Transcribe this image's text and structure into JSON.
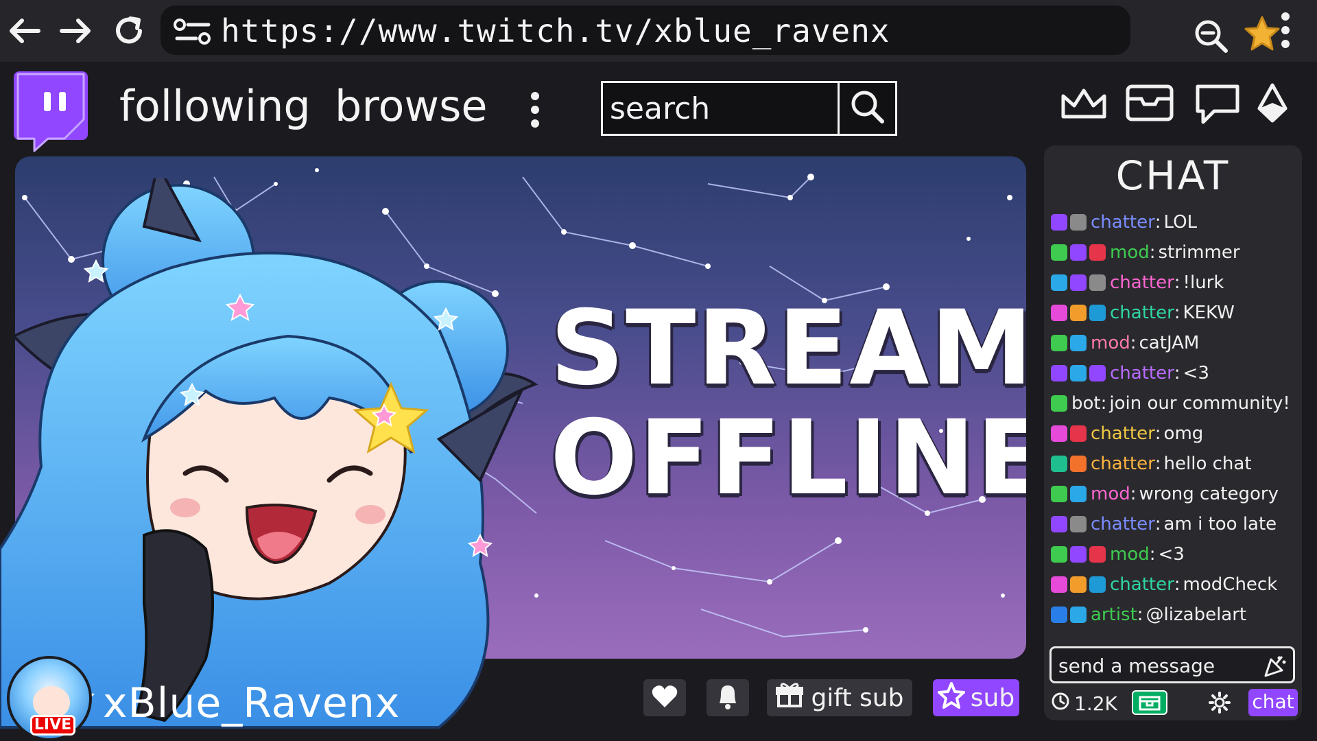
{
  "browser": {
    "url": "https://www.twitch.tv/xblue_ravenx"
  },
  "header": {
    "following_label": "following",
    "browse_label": "browse",
    "search_placeholder": "search"
  },
  "stream": {
    "offline_line1": "STREAM",
    "offline_line2": "OFFLINE"
  },
  "channel": {
    "name": "xBlue_Ravenx",
    "live_badge": "LIVE",
    "gift_label": "gift sub",
    "sub_label": "sub"
  },
  "chat": {
    "title": "CHAT",
    "messages": [
      {
        "user": "chatter",
        "text": "LOL",
        "color": "#7b8cff",
        "badges": [
          "#9147ff",
          "#8a8a8a"
        ]
      },
      {
        "user": "mod",
        "text": "strimmer",
        "color": "#3ecb4f",
        "badges": [
          "#3ecb4f",
          "#9147ff",
          "#e6344a"
        ]
      },
      {
        "user": "chatter",
        "text": "!lurk",
        "color": "#ff66d1",
        "badges": [
          "#2aa8e8",
          "#9147ff",
          "#8a8a8a"
        ]
      },
      {
        "user": "chatter",
        "text": "KEKW",
        "color": "#2fd6a0",
        "badges": [
          "#e64ad8",
          "#f29d2b",
          "#1e9ad6"
        ]
      },
      {
        "user": "mod",
        "text": "catJAM",
        "color": "#ff7aa8",
        "badges": [
          "#3ecb4f",
          "#2aa8e8"
        ]
      },
      {
        "user": "chatter",
        "text": "<3",
        "color": "#b96bff",
        "badges": [
          "#9147ff",
          "#2aa8e8",
          "#9147ff"
        ]
      },
      {
        "user": "bot",
        "text": "join our community!",
        "color": "#f0f0f0",
        "badges": [
          "#3ecb4f"
        ]
      },
      {
        "user": "chatter",
        "text": "omg",
        "color": "#f2c744",
        "badges": [
          "#e64ad8",
          "#e6344a"
        ]
      },
      {
        "user": "chatter",
        "text": "hello chat",
        "color": "#ffb340",
        "badges": [
          "#1fbf8f",
          "#f2712b"
        ]
      },
      {
        "user": "mod",
        "text": "wrong category",
        "color": "#ff66d1",
        "badges": [
          "#3ecb4f",
          "#2aa8e8"
        ]
      },
      {
        "user": "chatter",
        "text": "am i too late",
        "color": "#7b8cff",
        "badges": [
          "#9147ff",
          "#8a8a8a"
        ]
      },
      {
        "user": "mod",
        "text": "<3",
        "color": "#3ecb4f",
        "badges": [
          "#3ecb4f",
          "#9147ff",
          "#e6344a"
        ]
      },
      {
        "user": "chatter",
        "text": "modCheck",
        "color": "#2fd6a0",
        "badges": [
          "#e64ad8",
          "#f29d2b",
          "#1e9ad6"
        ]
      },
      {
        "user": "artist",
        "text": "@lizabelart",
        "color": "#3ecb4f",
        "badges": [
          "#2a7ee8",
          "#2aa8e8"
        ]
      }
    ],
    "message_placeholder": "send a message",
    "points": "1.2K",
    "chat_button": "chat"
  },
  "colors": {
    "brand": "#9147ff",
    "live": "#eb0400",
    "points": "#00ad62"
  },
  "icons": [
    "back-arrow-icon",
    "forward-arrow-icon",
    "reload-icon",
    "site-settings-icon",
    "zoom-out-icon",
    "star-bookmark-icon",
    "kebab-menu-icon",
    "twitch-logo-icon",
    "search-icon",
    "crown-icon",
    "inbox-icon",
    "whisper-icon",
    "bits-icon",
    "heart-icon",
    "bell-icon",
    "gift-icon",
    "star-icon",
    "emote-icon",
    "timer-icon",
    "gear-icon"
  ]
}
